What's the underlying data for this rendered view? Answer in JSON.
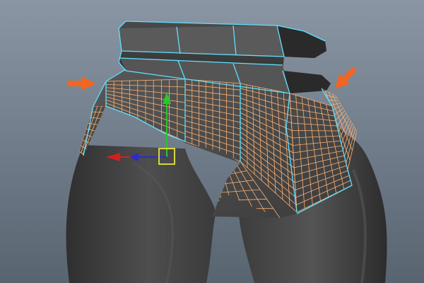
{
  "viewport": {
    "background_top": "#8a96a4",
    "background_bottom": "#586470",
    "model": "skirt-mesh",
    "mesh_wire_color": "#ffb070",
    "selection_outline_color": "#5fe0ff",
    "annotation_color": "#f26522"
  },
  "manipulator": {
    "y_axis_color": "#28c828",
    "x_axis_color": "#d61e1e",
    "z_axis_color": "#2a2ad6",
    "center_handle_color": "#e6e63c"
  },
  "annotations": [
    {
      "name": "left-arrow",
      "direction": "right",
      "icon": "arrow-right-icon"
    },
    {
      "name": "right-arrow",
      "direction": "down-left",
      "icon": "arrow-down-left-icon"
    }
  ]
}
